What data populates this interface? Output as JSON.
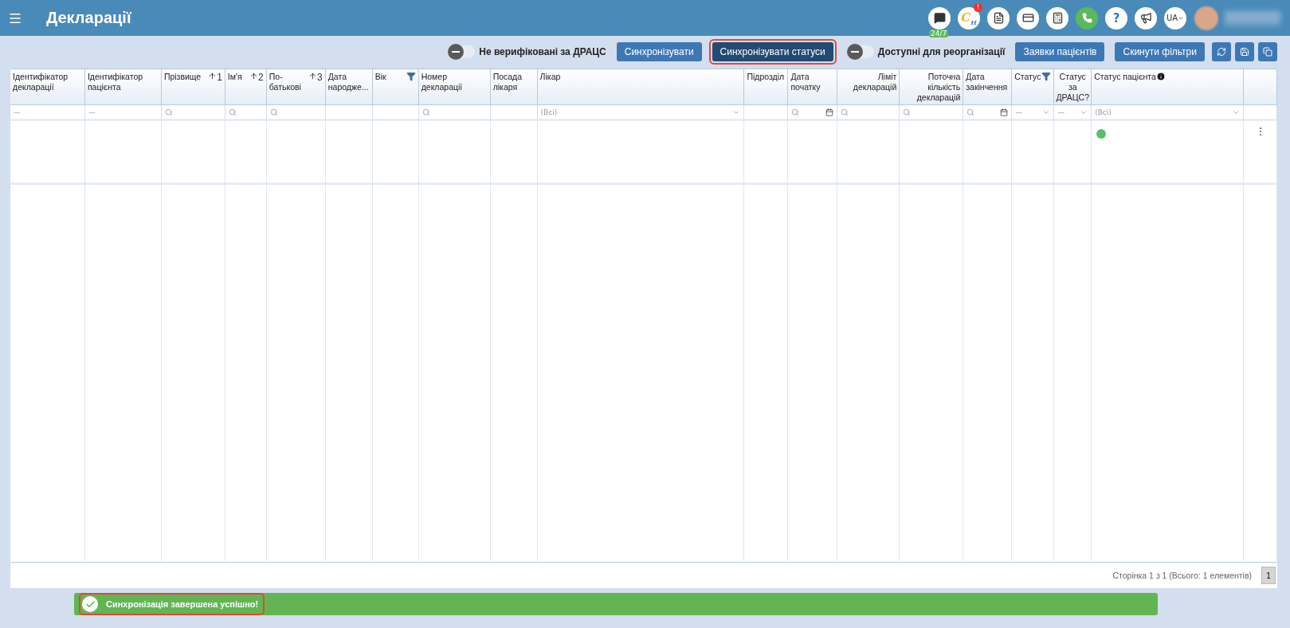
{
  "header": {
    "title": "Декларації",
    "chat_badge": "24/7",
    "logo_letters": "C",
    "logo_sub": "H",
    "logo_badge": "!",
    "help": "?",
    "language": "UA"
  },
  "toolbar": {
    "items": [
      {
        "kind": "toggle",
        "label": "Не верифіковані за ДРАЦС",
        "on": false
      },
      {
        "kind": "button",
        "label": "Синхронізувати",
        "highlighted": false,
        "dark": false
      },
      {
        "kind": "button",
        "label": "Синхронізувати статуси",
        "highlighted": true,
        "dark": true
      },
      {
        "kind": "toggle",
        "label": "Доступні для реорганізації",
        "on": false
      },
      {
        "kind": "button",
        "label": "Заявки пацієнтів",
        "highlighted": false,
        "dark": false
      },
      {
        "kind": "button",
        "label": "Скинути фільтри",
        "highlighted": false,
        "dark": false
      },
      {
        "kind": "icon"
      },
      {
        "kind": "icon"
      },
      {
        "kind": "icon"
      }
    ]
  },
  "table": {
    "columns": [
      {
        "label": "Ідентифікатор декларації",
        "filter": {
          "kind": "dash",
          "text": "—"
        }
      },
      {
        "label": "Ідентифікатор пацієнта",
        "filter": {
          "kind": "dash",
          "text": "—"
        }
      },
      {
        "label": "Прізвище",
        "sort": "1",
        "filter": {
          "kind": "search"
        }
      },
      {
        "label": "Ім'я",
        "sort": "2",
        "filter": {
          "kind": "search"
        }
      },
      {
        "label": "По-батькові",
        "sort": "3",
        "filter": {
          "kind": "search"
        }
      },
      {
        "label": "Дата народже..."
      },
      {
        "label": "Вік",
        "funnel": true
      },
      {
        "label": "Номер декларації",
        "filter": {
          "kind": "search"
        }
      },
      {
        "label": "Посада лікаря"
      },
      {
        "label": "Лікар",
        "filter": {
          "kind": "select",
          "text": "(Всі)"
        }
      },
      {
        "label": "Підрозділ"
      },
      {
        "label": "Дата початку",
        "filter": {
          "kind": "date"
        }
      },
      {
        "label": "Ліміт декларацій",
        "filter": {
          "kind": "search"
        }
      },
      {
        "label": "Поточна кількість декларацій",
        "filter": {
          "kind": "search"
        }
      },
      {
        "label": "Дата закінчення",
        "filter": {
          "kind": "date"
        }
      },
      {
        "label": "Статус",
        "funnel": true,
        "filter": {
          "kind": "select",
          "text": "—"
        }
      },
      {
        "label": "Статус за ДРАЦС?",
        "filter": {
          "kind": "select",
          "text": "—"
        }
      },
      {
        "label": "Статус пацієнта",
        "info": true,
        "filter": {
          "kind": "select",
          "text": "(Всі)"
        }
      },
      {}
    ]
  },
  "pager": {
    "summary": "Сторінка 1 з 1 (Всього: 1 елементів)",
    "pages": [
      {
        "label": "1",
        "selected": true
      }
    ]
  },
  "toast": {
    "message": "Синхронізація завершена успішно!",
    "highlighted": true
  }
}
